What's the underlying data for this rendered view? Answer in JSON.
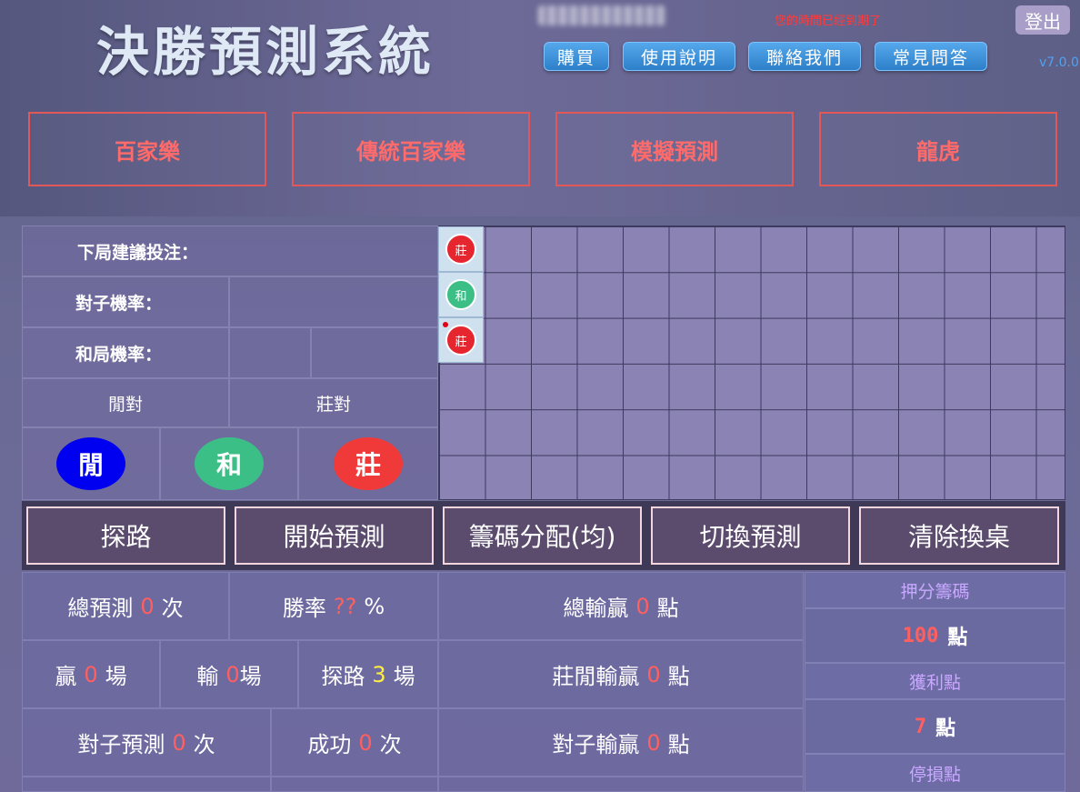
{
  "header": {
    "title": "決勝預測系統",
    "expire_message": "您的時間已經到期了",
    "logout_label": "登出",
    "version": "v7.0.0",
    "nav": [
      "購買",
      "使用說明",
      "聯絡我們",
      "常見問答"
    ]
  },
  "modes": [
    "百家樂",
    "傳統百家樂",
    "模擬預測",
    "龍虎"
  ],
  "info_panel": {
    "next_bet_label": "下局建議投注：",
    "pair_rate_label": "對子機率：",
    "tie_rate_label": "和局機率：",
    "player_pair": "閒對",
    "banker_pair": "莊對",
    "player_btn": "閒",
    "tie_btn": "和",
    "banker_btn": "莊"
  },
  "road": {
    "entries": [
      "莊",
      "和",
      "莊"
    ]
  },
  "actions": [
    "探路",
    "開始預測",
    "籌碼分配(均)",
    "切換預測",
    "清除換桌"
  ],
  "stats": {
    "total_pred_label": "總預測",
    "total_pred_value": "0",
    "total_pred_unit": "次",
    "win_rate_label": "勝率",
    "win_rate_value": "??",
    "win_rate_unit": "%",
    "total_win_loss_label": "總輸贏",
    "total_win_loss_value": "0",
    "total_win_loss_unit": "點",
    "win_label": "贏",
    "win_value": "0",
    "win_unit": "場",
    "lose_label": "輸",
    "lose_value": "0",
    "lose_unit": "場",
    "probe_label": "探路",
    "probe_value": "3",
    "probe_unit": "場",
    "bp_win_loss_label": "莊閒輸贏",
    "bp_win_loss_value": "0",
    "bp_win_loss_unit": "點",
    "pair_pred_label": "對子預測",
    "pair_pred_value": "0",
    "pair_pred_unit": "次",
    "success_label": "成功",
    "success_value": "0",
    "success_unit": "次",
    "pair_win_loss_label": "對子輸贏",
    "pair_win_loss_value": "0",
    "pair_win_loss_unit": "點"
  },
  "side": {
    "bet_chip_label": "押分籌碼",
    "bet_chip_value": "100",
    "bet_chip_unit": "點",
    "profit_label": "獲利點",
    "profit_value": "7",
    "profit_unit": "點",
    "stop_loss_label": "停損點"
  },
  "colors": {
    "player_blue": "#0000f0",
    "tie_green": "#3bbf86",
    "banker_red": "#f03a3a",
    "accent_red": "#ff5f5f"
  }
}
